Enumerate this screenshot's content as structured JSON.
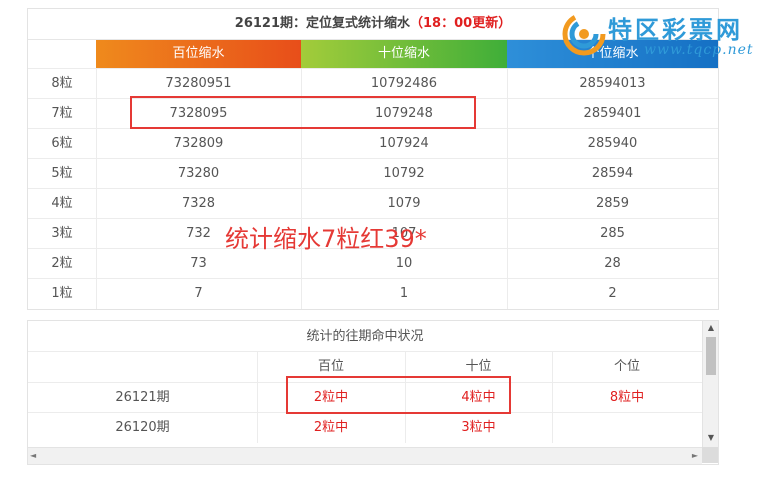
{
  "stats": {
    "title_main": "26121期：定位复式统计缩水",
    "title_update": "（18：00更新）",
    "headers": [
      "百位缩水",
      "十位缩水",
      "个位缩水"
    ],
    "rows": [
      {
        "label": "8粒",
        "bai": "73280951",
        "shi": "10792486",
        "ge": "28594013"
      },
      {
        "label": "7粒",
        "bai": "7328095",
        "shi": "1079248",
        "ge": "2859401"
      },
      {
        "label": "6粒",
        "bai": "732809",
        "shi": "107924",
        "ge": "285940"
      },
      {
        "label": "5粒",
        "bai": "73280",
        "shi": "10792",
        "ge": "28594"
      },
      {
        "label": "4粒",
        "bai": "7328",
        "shi": "1079",
        "ge": "2859"
      },
      {
        "label": "3粒",
        "bai": "732",
        "shi": "107",
        "ge": "285"
      },
      {
        "label": "2粒",
        "bai": "73",
        "shi": "10",
        "ge": "28"
      },
      {
        "label": "1粒",
        "bai": "7",
        "shi": "1",
        "ge": "2"
      }
    ]
  },
  "overlay_text": "统计缩水7粒红39*",
  "logo": {
    "brand": "特区彩票网",
    "url": "www.tqcp.net",
    "colors": {
      "brand": "#2f9ad8",
      "swirl_orange": "#f29a1f",
      "swirl_blue": "#2f9ad8"
    }
  },
  "history": {
    "title": "统计的往期命中状况",
    "headers": [
      "",
      "百位",
      "十位",
      "个位"
    ],
    "rows": [
      {
        "period": "26121期",
        "bai": "2粒中",
        "shi": "4粒中",
        "ge": "8粒中"
      },
      {
        "period": "26120期",
        "bai": "2粒中",
        "shi": "3粒中",
        "ge": ""
      }
    ]
  },
  "scroll": {
    "up": "▲",
    "down": "▼",
    "left": "◄",
    "right": "►"
  },
  "colors": {
    "highlight": "#e53935",
    "hit": "#e02020",
    "bai": "#e84e1a",
    "shi": "#3fae39",
    "ge": "#1570c4"
  }
}
